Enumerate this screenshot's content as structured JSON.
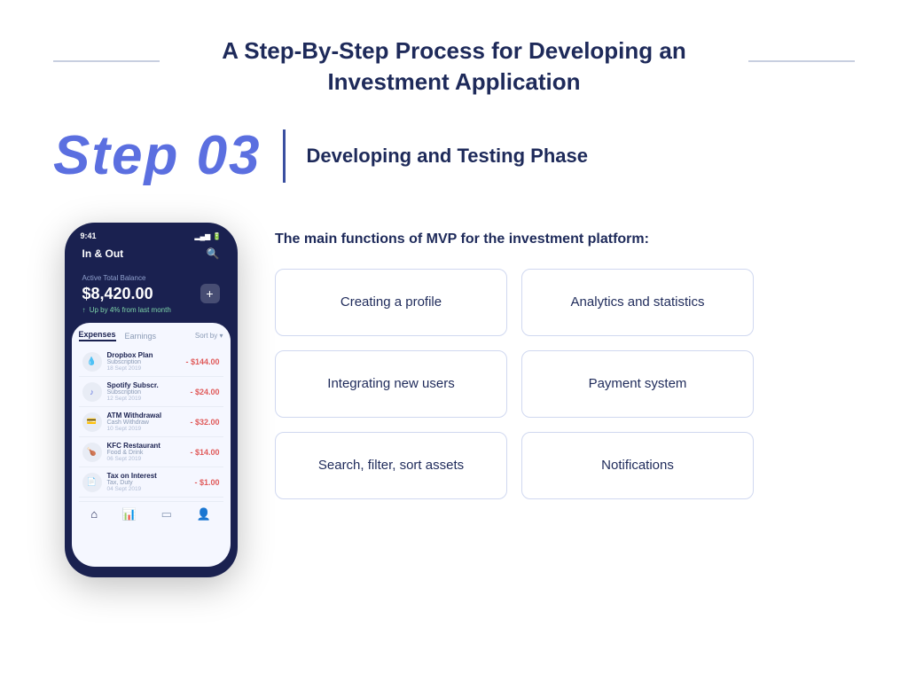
{
  "header": {
    "title_line1": "A Step-By-Step Process for Developing an",
    "title_line2": "Investment Application"
  },
  "step": {
    "label": "Step 03",
    "divider": "|",
    "subtitle": "Developing and Testing Phase"
  },
  "phone": {
    "time": "9:41",
    "signal": "▂▄▆",
    "app_title": "In & Out",
    "balance_label": "Active Total Balance",
    "balance": "$8,420.00",
    "plus": "+",
    "growth": "Up by 4% from last month",
    "tab_expenses": "Expenses",
    "tab_earnings": "Earnings",
    "sort": "Sort by ▾",
    "transactions": [
      {
        "icon": "💧",
        "name": "Dropbox Plan",
        "category": "Subscription",
        "date": "18 Sept 2019",
        "amount": "- $144.00"
      },
      {
        "icon": "♪",
        "name": "Spotify Subscr.",
        "category": "Subscription",
        "date": "12 Sept 2019",
        "amount": "- $24.00"
      },
      {
        "icon": "🏧",
        "name": "ATM Withdrawal",
        "category": "Cash Withdraw",
        "date": "10 Sept 2019",
        "amount": "- $32.00"
      },
      {
        "icon": "🍗",
        "name": "KFC Restaurant",
        "category": "Food & Drink",
        "date": "06 Sept 2019",
        "amount": "- $14.00"
      },
      {
        "icon": "📄",
        "name": "Tax on Interest",
        "category": "Tax, Duty",
        "date": "04 Sept 2019",
        "amount": "- $1.00"
      }
    ]
  },
  "mvp": {
    "title": "The main functions of MVP for the investment platform:",
    "features": [
      {
        "id": "creating-profile",
        "label": "Creating a profile"
      },
      {
        "id": "analytics-statistics",
        "label": "Analytics and statistics"
      },
      {
        "id": "integrating-users",
        "label": "Integrating new users"
      },
      {
        "id": "payment-system",
        "label": "Payment system"
      },
      {
        "id": "search-filter",
        "label": "Search, filter, sort assets"
      },
      {
        "id": "notifications",
        "label": "Notifications"
      }
    ]
  }
}
